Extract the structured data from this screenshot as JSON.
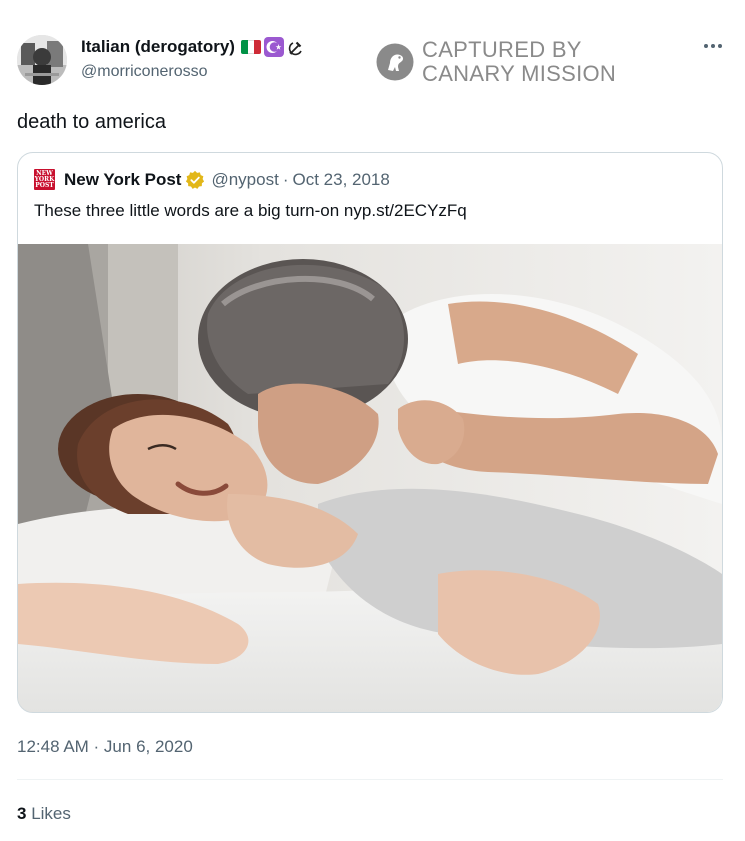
{
  "tweet": {
    "display_name": "Italian (derogatory)",
    "name_emojis": [
      "italian-flag",
      "star-and-crescent",
      "hammer-and-sickle"
    ],
    "handle": "@morriconerosso",
    "text": "death to america",
    "timestamp": "12:48 AM · Jun 6, 2020",
    "likes_count": "3",
    "likes_label": "Likes"
  },
  "watermark": {
    "line1": "CAPTURED BY",
    "line2": "CANARY MISSION",
    "color": "#8a8a8a"
  },
  "quote": {
    "name": "New York Post",
    "handle": "@nypost",
    "date": "Oct 23, 2018",
    "separator": "·",
    "text": "These three little words are a big turn-on nyp.st/2ECYzFq",
    "logo_color": "#c8102e",
    "badge_color": "#e2b719"
  },
  "colors": {
    "text_primary": "#0f1419",
    "text_secondary": "#536471",
    "border": "#cfd9de"
  }
}
